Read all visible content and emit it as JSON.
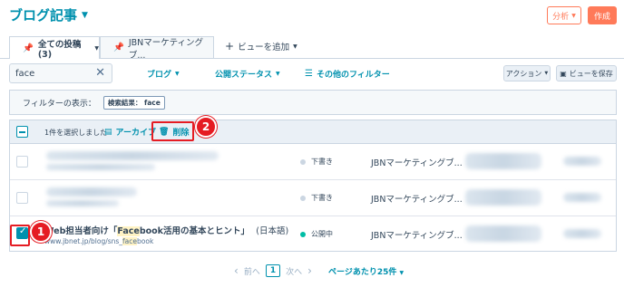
{
  "header": {
    "title": "ブログ記事",
    "analyze_label": "分析",
    "create_label": "作成"
  },
  "tabs": [
    {
      "label": "全ての投稿 (3)"
    },
    {
      "label": "JBNマーケティングブ..."
    }
  ],
  "add_view_label": "ビューを追加",
  "search": {
    "value": "face"
  },
  "filters": {
    "blog_label": "ブログ",
    "status_label": "公開ステータス",
    "more_label": "その他のフィルター",
    "action_label": "アクション",
    "save_view_label": "ビューを保存"
  },
  "filter_display": {
    "label": "フィルターの表示：",
    "tag": "検索結果： face"
  },
  "bulk": {
    "selected_text": "1件を選択しました",
    "archive_label": "アーカイブ",
    "delete_label": "削除"
  },
  "rows": [
    {
      "status": "下書き",
      "author": "JBNマーケティングブ..."
    },
    {
      "status": "下書き",
      "author": "JBNマーケティングブ..."
    },
    {
      "title_pre": "Web担当者向け「",
      "title_hl": "Face",
      "title_post": "book活用の基本とヒント」",
      "lang": "(日本語)",
      "url_pre": "www.jbnet.jp/blog/sns_",
      "url_hl": "face",
      "url_post": "book",
      "status": "公開中",
      "author": "JBNマーケティングブ..."
    }
  ],
  "pagination": {
    "prev_label": "前へ",
    "current_page": "1",
    "next_label": "次へ",
    "per_page_label": "ページあたり25件"
  },
  "callouts": {
    "one": "1",
    "two": "2"
  },
  "colors": {
    "accent": "#0091ae",
    "orange": "#ff7a59",
    "callout_red": "#e51c23",
    "live_status": "#00bda5"
  }
}
